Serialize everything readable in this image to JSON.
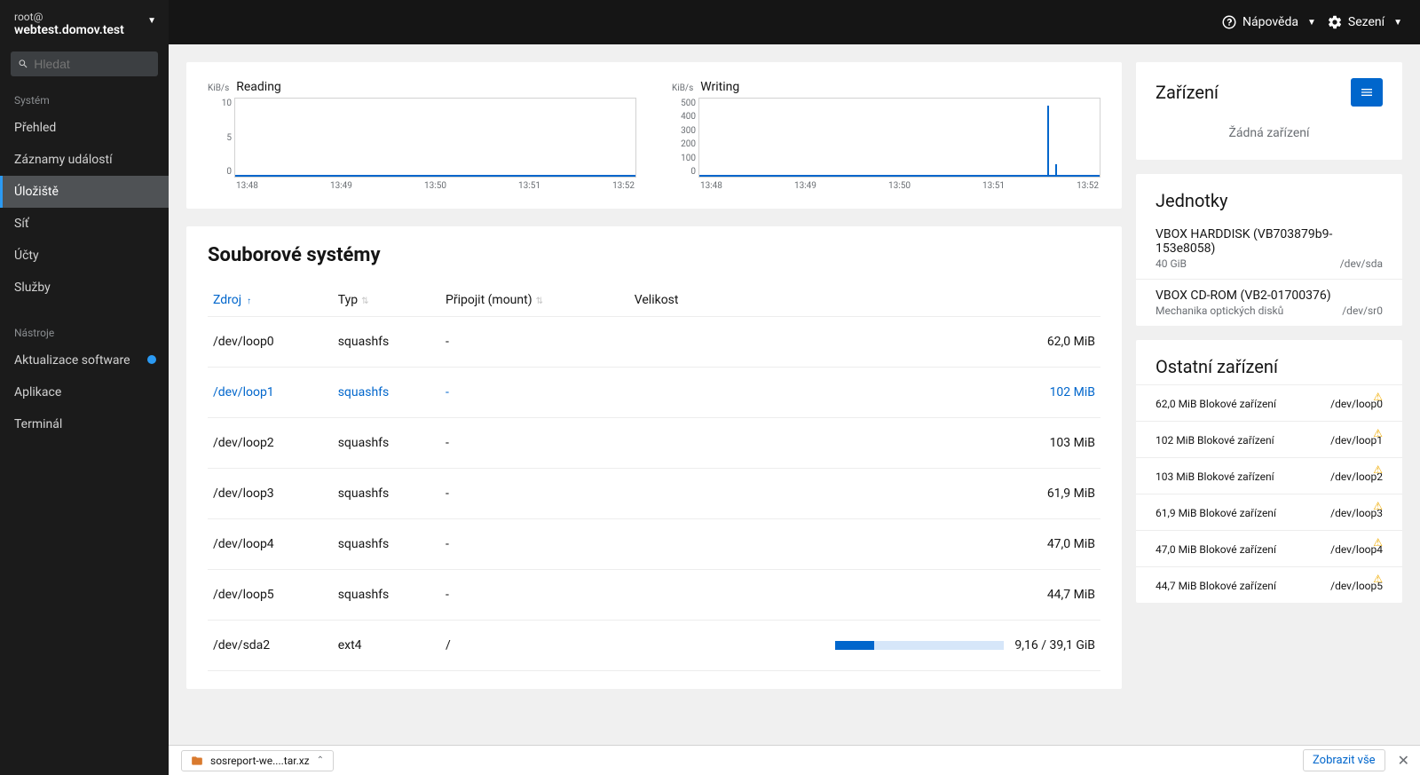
{
  "sidebar": {
    "user": "root@",
    "host": "webtest.domov.test",
    "search_placeholder": "Hledat",
    "group_system": "Systém",
    "group_tools": "Nástroje",
    "items_system": [
      {
        "label": "Přehled",
        "active": false
      },
      {
        "label": "Záznamy událostí",
        "active": false
      },
      {
        "label": "Úložiště",
        "active": true
      },
      {
        "label": "Síť",
        "active": false
      },
      {
        "label": "Účty",
        "active": false
      },
      {
        "label": "Služby",
        "active": false
      }
    ],
    "items_tools": [
      {
        "label": "Aktualizace software",
        "badge": true
      },
      {
        "label": "Aplikace"
      },
      {
        "label": "Terminál"
      }
    ]
  },
  "topbar": {
    "help": "Nápověda",
    "session": "Sezení"
  },
  "charts": {
    "unit": "KiB/s",
    "reading": {
      "title": "Reading"
    },
    "writing": {
      "title": "Writing"
    },
    "xticks": [
      "13:48",
      "13:49",
      "13:50",
      "13:51",
      "13:52"
    ]
  },
  "chart_data": [
    {
      "type": "line",
      "title": "Reading",
      "xlabel": "",
      "ylabel": "KiB/s",
      "ylim": [
        0,
        10
      ],
      "yticks": [
        0,
        5,
        10
      ],
      "x": [
        "13:48",
        "13:49",
        "13:50",
        "13:51",
        "13:52"
      ],
      "series": [
        {
          "name": "Reading",
          "values": [
            0,
            0,
            0,
            0,
            0
          ]
        }
      ]
    },
    {
      "type": "line",
      "title": "Writing",
      "xlabel": "",
      "ylabel": "KiB/s",
      "ylim": [
        0,
        500
      ],
      "yticks": [
        0,
        100,
        200,
        300,
        400,
        500
      ],
      "x": [
        "13:48",
        "13:49",
        "13:50",
        "13:51",
        "13:52"
      ],
      "series": [
        {
          "name": "Writing",
          "values": [
            0,
            0,
            0,
            0,
            460
          ]
        }
      ],
      "note": "Single spike ~460 KiB/s shortly before 13:52, small secondary ~80 KiB/s"
    }
  ],
  "filesystems": {
    "title": "Souborové systémy",
    "columns": {
      "source": "Zdroj",
      "type": "Typ",
      "mount": "Připojit (mount)",
      "size": "Velikost"
    },
    "rows": [
      {
        "source": "/dev/loop0",
        "type": "squashfs",
        "mount": "-",
        "size": "62,0 MiB"
      },
      {
        "source": "/dev/loop1",
        "type": "squashfs",
        "mount": "-",
        "size": "102 MiB",
        "hover": true
      },
      {
        "source": "/dev/loop2",
        "type": "squashfs",
        "mount": "-",
        "size": "103 MiB"
      },
      {
        "source": "/dev/loop3",
        "type": "squashfs",
        "mount": "-",
        "size": "61,9 MiB"
      },
      {
        "source": "/dev/loop4",
        "type": "squashfs",
        "mount": "-",
        "size": "47,0 MiB"
      },
      {
        "source": "/dev/loop5",
        "type": "squashfs",
        "mount": "-",
        "size": "44,7 MiB"
      },
      {
        "source": "/dev/sda2",
        "type": "ext4",
        "mount": "/",
        "size": "9,16 / 39,1 GiB",
        "usage_pct": 23
      }
    ]
  },
  "devices_card": {
    "title": "Zařízení",
    "empty": "Žádná zařízení"
  },
  "drives_card": {
    "title": "Jednotky",
    "items": [
      {
        "name": "VBOX HARDDISK (VB703879b9-153e8058)",
        "sub": "40 GiB",
        "path": "/dev/sda"
      },
      {
        "name": "VBOX CD-ROM (VB2-01700376)",
        "sub": "Mechanika optických disků",
        "path": "/dev/sr0"
      }
    ]
  },
  "other_card": {
    "title": "Ostatní zařízení",
    "items": [
      {
        "desc": "62,0 MiB Blokové zařízení",
        "path": "/dev/loop0"
      },
      {
        "desc": "102 MiB Blokové zařízení",
        "path": "/dev/loop1"
      },
      {
        "desc": "103 MiB Blokové zařízení",
        "path": "/dev/loop2"
      },
      {
        "desc": "61,9 MiB Blokové zařízení",
        "path": "/dev/loop3"
      },
      {
        "desc": "47,0 MiB Blokové zařízení",
        "path": "/dev/loop4"
      },
      {
        "desc": "44,7 MiB Blokové zařízení",
        "path": "/dev/loop5"
      }
    ]
  },
  "download_bar": {
    "filename": "sosreport-we....tar.xz",
    "show_all": "Zobrazit vše"
  }
}
